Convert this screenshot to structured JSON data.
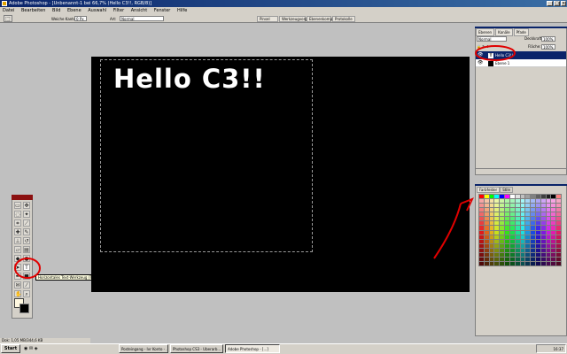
{
  "window": {
    "title": "Adobe Photoshop - [Unbenannt-1 bei 66,7% (Hello C3!!, RGB/8)]",
    "min": "_",
    "max": "□",
    "close": "×"
  },
  "menu": [
    "Datei",
    "Bearbeiten",
    "Bild",
    "Ebene",
    "Auswahl",
    "Filter",
    "Ansicht",
    "Fenster",
    "Hilfe"
  ],
  "options": {
    "font_size_label": "Weiche Kante:",
    "font_size_value": "0 Px",
    "mode_label": "Art:",
    "mode_value": "Normal",
    "tabs": [
      "Pinsel",
      "Werkzeugvorgaben",
      "Ebenenkomp.",
      "Protokolle"
    ]
  },
  "canvas": {
    "text": "Hello C3!!"
  },
  "layers": {
    "tabs": [
      "Ebenen",
      "Kanäle",
      "Pfade"
    ],
    "blend_mode": "Normal",
    "opacity_label": "Deckkraft:",
    "opacity_value": "100%",
    "fill_label": "Fläche:",
    "fill_value": "100%",
    "items": [
      {
        "name": "Hello C3!!",
        "type": "T"
      },
      {
        "name": "Ebene 1",
        "type": ""
      }
    ]
  },
  "swatches": {
    "tabs": [
      "Farbfelder",
      "Stile"
    ],
    "colors": [
      "#ff0000",
      "#ffff00",
      "#00ff00",
      "#00ffff",
      "#0000ff",
      "#ff00ff",
      "#ffffff",
      "#e0e0e0",
      "#c0c0c0",
      "#a0a0a0",
      "#808080",
      "#606060",
      "#404040",
      "#202020",
      "#000000",
      "#ff8080"
    ]
  },
  "toolbox": {
    "tooltip": "Horizontales Text-Werkzeug (T)"
  },
  "status": {
    "text": "Dok: 1,05 MB/344,6 KB"
  },
  "taskbar": {
    "start": "Start",
    "tasks": [
      "Posteingang - Ivr Konto - ...",
      "Photoshop CS3 - Uberarb...",
      "Adobe Photoshop - [...]"
    ],
    "clock": "16:37"
  },
  "colors": {
    "accent": "#0a246a",
    "annotation": "#e00000"
  }
}
